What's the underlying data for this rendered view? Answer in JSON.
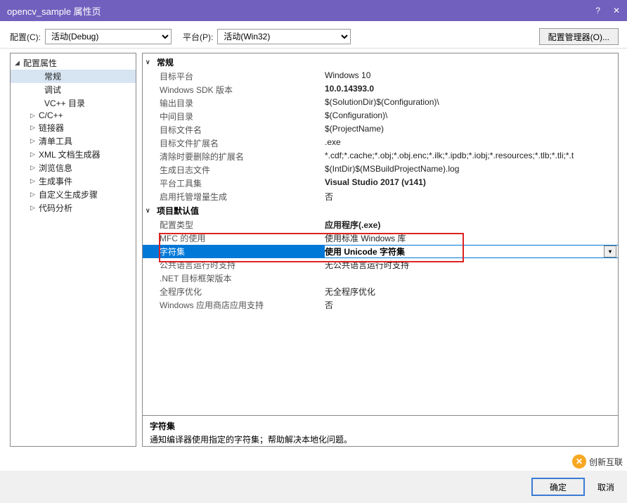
{
  "titlebar": {
    "title": "opencv_sample 属性页"
  },
  "toprow": {
    "config_label": "配置(C):",
    "config_value": "活动(Debug)",
    "platform_label": "平台(P):",
    "platform_value": "活动(Win32)",
    "cfgmgr": "配置管理器(O)..."
  },
  "tree": {
    "root": "配置属性",
    "items": [
      "常规",
      "调试",
      "VC++ 目录",
      "C/C++",
      "链接器",
      "清单工具",
      "XML 文档生成器",
      "浏览信息",
      "生成事件",
      "自定义生成步骤",
      "代码分析"
    ]
  },
  "sections": {
    "general": {
      "title": "常规",
      "rows": [
        {
          "label": "目标平台",
          "value": "Windows 10",
          "bold": false
        },
        {
          "label": "Windows SDK 版本",
          "value": "10.0.14393.0",
          "bold": true
        },
        {
          "label": "输出目录",
          "value": "$(SolutionDir)$(Configuration)\\"
        },
        {
          "label": "中间目录",
          "value": "$(Configuration)\\"
        },
        {
          "label": "目标文件名",
          "value": "$(ProjectName)"
        },
        {
          "label": "目标文件扩展名",
          "value": ".exe"
        },
        {
          "label": "清除时要删除的扩展名",
          "value": "*.cdf;*.cache;*.obj;*.obj.enc;*.ilk;*.ipdb;*.iobj;*.resources;*.tlb;*.tli;*.t"
        },
        {
          "label": "生成日志文件",
          "value": "$(IntDir)$(MSBuildProjectName).log"
        },
        {
          "label": "平台工具集",
          "value": "Visual Studio 2017 (v141)",
          "bold": true
        },
        {
          "label": "启用托管增量生成",
          "value": "否"
        }
      ]
    },
    "defaults": {
      "title": "项目默认值",
      "rows": [
        {
          "label": "配置类型",
          "value": "应用程序(.exe)",
          "bold": true
        },
        {
          "label": "MFC 的使用",
          "value": "使用标准 Windows 库"
        },
        {
          "label": "字符集",
          "value": "使用 Unicode 字符集",
          "bold": true,
          "selected": true
        },
        {
          "label": "公共语言运行时支持",
          "value": "无公共语言运行时支持"
        },
        {
          "label": ".NET 目标框架版本",
          "value": ""
        },
        {
          "label": "全程序优化",
          "value": "无全程序优化"
        },
        {
          "label": "Windows 应用商店应用支持",
          "value": "否"
        }
      ]
    }
  },
  "description": {
    "title": "字符集",
    "text": "通知编译器使用指定的字符集；帮助解决本地化问题。"
  },
  "buttons": {
    "ok": "确定",
    "cancel": "取消"
  },
  "watermark": "创新互联"
}
